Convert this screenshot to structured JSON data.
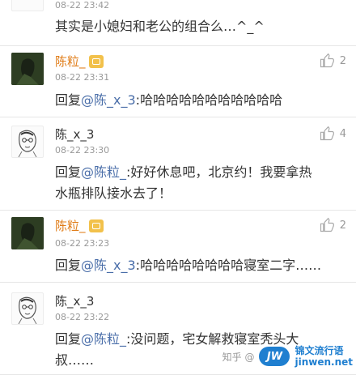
{
  "comments": [
    {
      "timestamp": "08-22 23:42",
      "body": "其实是小媳妇和老公的组合么…^_^"
    },
    {
      "username": "陈粒_",
      "timestamp": "08-22 23:31",
      "likes": "2",
      "reply_prefix": "回复",
      "mention": "@陈_x_3",
      "body": ":哈哈哈哈哈哈哈哈哈哈哈"
    },
    {
      "username": "陈_x_3",
      "timestamp": "08-22 23:30",
      "likes": "4",
      "reply_prefix": "回复",
      "mention": "@陈粒_",
      "body": ":好好休息吧，北京约！我要拿热",
      "body2": "水瓶排队接水去了！"
    },
    {
      "username": "陈粒_",
      "timestamp": "08-22 23:23",
      "likes": "2",
      "reply_prefix": "回复",
      "mention": "@陈_x_3",
      "body": ":哈哈哈哈哈哈哈哈寝室二字……"
    },
    {
      "username": "陈_x_3",
      "timestamp": "08-22 23:22",
      "reply_prefix": "回复",
      "mention": "@陈粒_",
      "body": ":没问题，宅女解救寝室秃头大",
      "body2": "叔……"
    }
  ],
  "watermark": {
    "zhihu": "知乎 @",
    "logo": "JW",
    "cn": "锦文流行语",
    "en": "jinwen.net"
  },
  "colors": {
    "username_orange": "#e07c17",
    "mention_blue": "#4a6ea9",
    "time_gray": "#999999"
  }
}
